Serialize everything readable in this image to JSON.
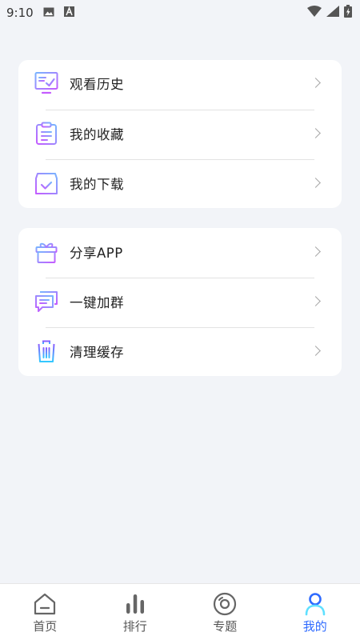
{
  "status_bar": {
    "time": "9:10",
    "icons": [
      "image-icon",
      "font-a-icon",
      "wifi-icon",
      "signal-icon",
      "battery-charging-icon"
    ]
  },
  "menu_group_1": [
    {
      "label": "观看历史",
      "icon": "monitor-check-icon"
    },
    {
      "label": "我的收藏",
      "icon": "clipboard-icon"
    },
    {
      "label": "我的下载",
      "icon": "download-box-icon"
    }
  ],
  "menu_group_2": [
    {
      "label": "分享APP",
      "icon": "gift-icon"
    },
    {
      "label": "一键加群",
      "icon": "chat-bubbles-icon"
    },
    {
      "label": "清理缓存",
      "icon": "trash-icon"
    }
  ],
  "tab_bar": {
    "tabs": [
      {
        "label": "首页",
        "icon": "home-icon",
        "active": false
      },
      {
        "label": "排行",
        "icon": "bars-icon",
        "active": false
      },
      {
        "label": "专题",
        "icon": "disc-icon",
        "active": false
      },
      {
        "label": "我的",
        "icon": "user-icon",
        "active": true
      }
    ]
  },
  "colors": {
    "accent": "#2f6bff",
    "gradient_start": "#7aa8ff",
    "gradient_end": "#c65bff",
    "background": "#f2f4f8"
  }
}
